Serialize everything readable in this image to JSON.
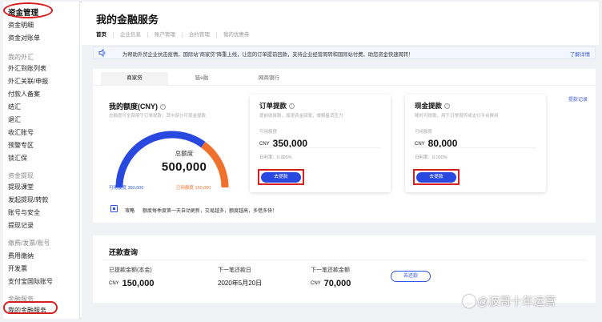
{
  "sidebar": {
    "title": "资金管理",
    "items": [
      {
        "label": "资金明细",
        "group": false
      },
      {
        "label": "资金对账单",
        "group": false
      },
      {
        "label": "我的外汇",
        "group": true
      },
      {
        "label": "外汇到账列表",
        "group": false
      },
      {
        "label": "外汇关联/申报",
        "group": false
      },
      {
        "label": "付款人备案",
        "group": false
      },
      {
        "label": "结汇",
        "group": false
      },
      {
        "label": "退汇",
        "group": false
      },
      {
        "label": "收汇账号",
        "group": false
      },
      {
        "label": "预警专区",
        "group": false
      },
      {
        "label": "锁汇保",
        "group": false
      },
      {
        "label": "资金提现",
        "group": true
      },
      {
        "label": "提现课堂",
        "group": false
      },
      {
        "label": "发起提现/转款",
        "group": false
      },
      {
        "label": "账号与安全",
        "group": false
      },
      {
        "label": "提现记录",
        "group": false
      },
      {
        "label": "缴费/发票/账号",
        "group": true
      },
      {
        "label": "费用缴纳",
        "group": false
      },
      {
        "label": "开发票",
        "group": false
      },
      {
        "label": "支付宝国际账号",
        "group": false
      },
      {
        "label": "金融服务",
        "group": true
      },
      {
        "label": "我的金融服务",
        "group": false
      }
    ]
  },
  "header": {
    "title": "我的金融服务",
    "tabs": [
      "首页",
      "企业信息",
      "账户管理",
      "合约管理",
      "我的优惠券"
    ]
  },
  "notice": {
    "text": "为帮助外贸企业抗击疫情，国际站\"商家贷\"降重上线，让您的订单提前回款，支持企业经营周转和国际站付费，助您资金快速周转！",
    "link": "了解详情"
  },
  "product_tabs": [
    "商家贷",
    "链e融",
    "网商银行"
  ],
  "record_link": "提款记录",
  "quota": {
    "title": "我的额度(CNY)",
    "subtitle": "总额度可全部用于订单提款，其中部分可现金提款",
    "total_label": "总额度",
    "total_value": "500,000",
    "available_label": "可用额度 350,000",
    "used_label": "已用额度 150,000",
    "available_fraction": 0.7
  },
  "order_loan": {
    "title": "订单提款",
    "desc": "提前收尾款，加速资金回笼，缓解备货压力",
    "available_label": "可用额度",
    "currency": "CNY",
    "amount": "350,000",
    "rate": "日利率：0.025%",
    "button": "去提款"
  },
  "cash_loan": {
    "title": "现金提款",
    "desc": "随时可提款，用于日常周转或支付平台费用",
    "available_label": "可用额度",
    "currency": "CNY",
    "amount": "80,000",
    "rate": "日利率：0.030%",
    "button": "去提款"
  },
  "strategy": {
    "label": "攻略",
    "text": "额度每季度第一天自动更新，交易越多，额度越高，多借多快！"
  },
  "repay": {
    "title": "还款查询",
    "paid_label": "已提款金额(本金)",
    "paid_currency": "CNY",
    "paid_value": "150,000",
    "next_date_label": "下一笔还款日",
    "next_date": "2020年5月20日",
    "next_amount_label": "下一笔还款金额",
    "next_amount_currency": "CNY",
    "next_amount": "70,000",
    "button": "去还款"
  },
  "watermark": "@波哥十年运营",
  "colors": {
    "accent": "#2848e0",
    "gauge_used": "#f0712e",
    "highlight_ring": "#d81f1f"
  }
}
